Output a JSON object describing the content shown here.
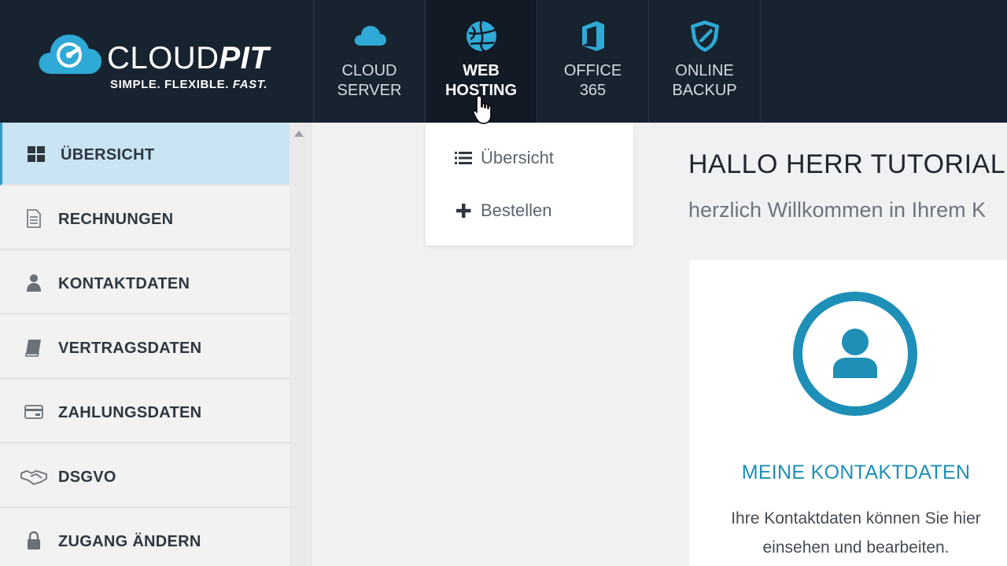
{
  "brand": {
    "name_light": "CLOUD",
    "name_bold": "PIT",
    "tagline_main": "SIMPLE. FLEXIBLE. ",
    "tagline_fast": "FAST."
  },
  "nav": {
    "items": [
      {
        "line1": "CLOUD",
        "line2": "SERVER",
        "icon": "cloud-icon"
      },
      {
        "line1": "WEB",
        "line2": "HOSTING",
        "icon": "globe-icon",
        "active": true
      },
      {
        "line1": "OFFICE",
        "line2": "365",
        "icon": "office-icon"
      },
      {
        "line1": "ONLINE",
        "line2": "BACKUP",
        "icon": "shield-icon"
      }
    ]
  },
  "dropdown": {
    "items": [
      {
        "label": "Übersicht",
        "icon": "list-icon"
      },
      {
        "label": "Bestellen",
        "icon": "plus-icon"
      }
    ]
  },
  "sidebar": {
    "items": [
      {
        "label": "ÜBERSICHT",
        "icon": "grid-icon",
        "active": true
      },
      {
        "label": "RECHNUNGEN",
        "icon": "document-icon"
      },
      {
        "label": "KONTAKTDATEN",
        "icon": "user-icon"
      },
      {
        "label": "VERTRAGSDATEN",
        "icon": "book-icon"
      },
      {
        "label": "ZAHLUNGSDATEN",
        "icon": "credit-card-icon"
      },
      {
        "label": "DSGVO",
        "icon": "handshake-icon"
      },
      {
        "label": "ZUGANG ÄNDERN",
        "icon": "lock-icon"
      }
    ]
  },
  "main": {
    "greeting": "HALLO HERR TUTORIAL,",
    "subgreeting": "herzlich Willkommen in Ihrem K",
    "card": {
      "title": "MEINE KONTAKTDATEN",
      "text_line1": "Ihre Kontaktdaten können Sie hier",
      "text_line2": "einsehen und bearbeiten.",
      "icon": "user-circle-icon"
    }
  },
  "colors": {
    "topbar": "#182330",
    "accent": "#1e8fb7",
    "sidebar_active": "#c9e4f2"
  }
}
